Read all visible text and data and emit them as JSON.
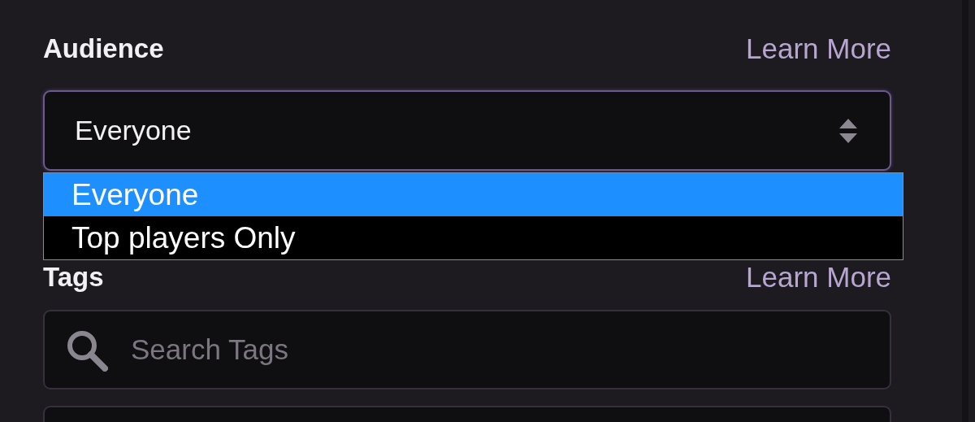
{
  "audience": {
    "label": "Audience",
    "link": "Learn More",
    "select": {
      "value": "Everyone",
      "expanded": true,
      "options": [
        {
          "label": "Everyone",
          "selected": true
        },
        {
          "label": "Top players Only",
          "selected": false
        }
      ]
    }
  },
  "tags": {
    "label": "Tags",
    "link": "Learn More",
    "search": {
      "placeholder": "Search Tags"
    }
  }
}
